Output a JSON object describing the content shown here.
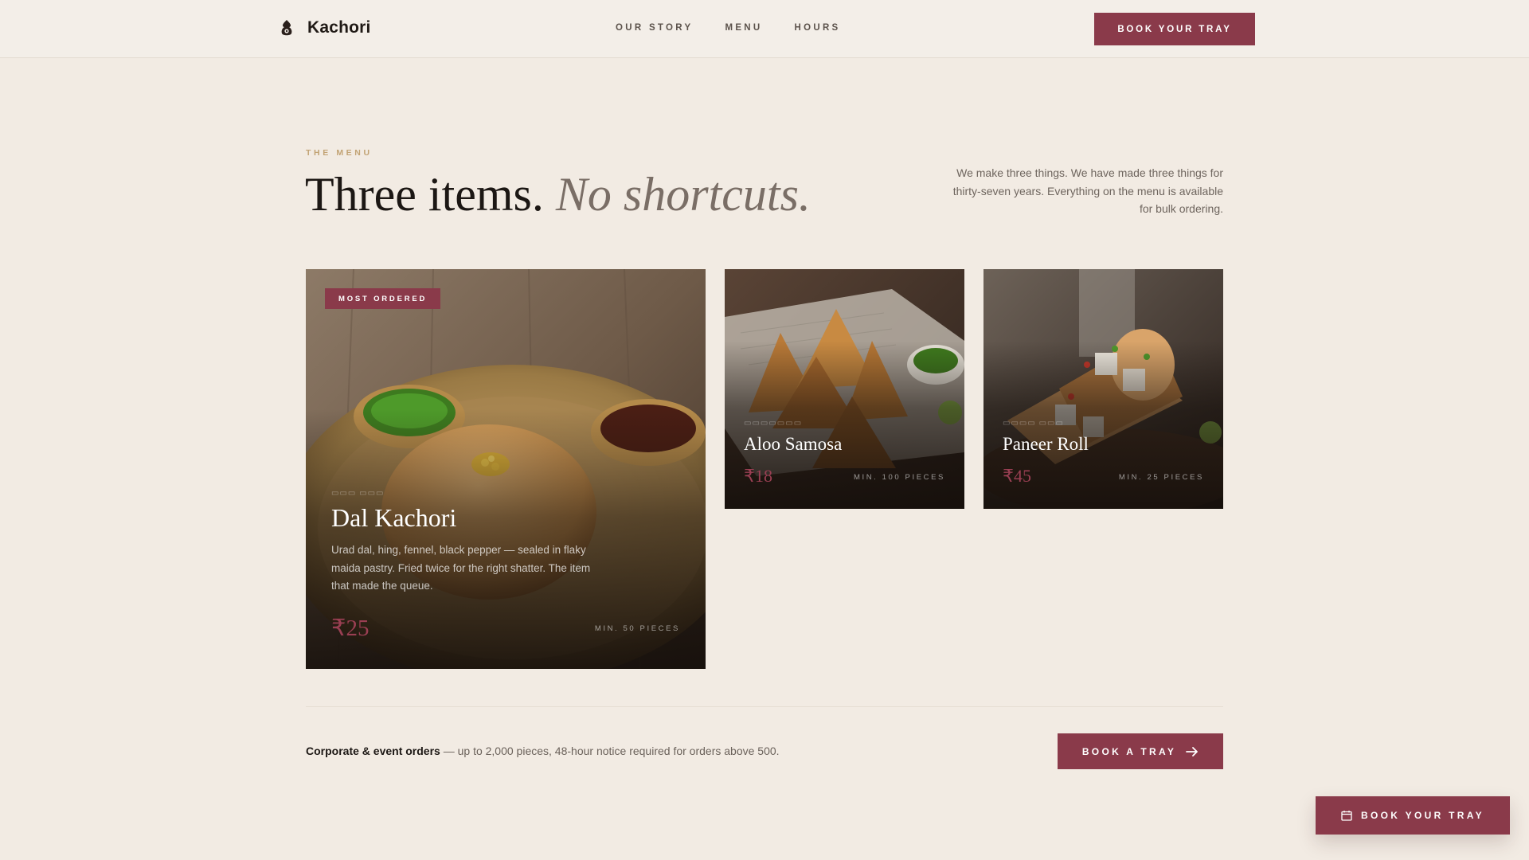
{
  "header": {
    "brand_name": "Kachori",
    "nav": [
      "OUR STORY",
      "MENU",
      "HOURS"
    ],
    "cta_label": "BOOK YOUR TRAY"
  },
  "intro": {
    "eyebrow": "THE MENU",
    "headline_main": "Three items.",
    "headline_italic": "No shortcuts.",
    "copy": "We make three things. We have made three things for thirty-seven years. Everything on the menu is available for bulk ordering."
  },
  "items": [
    {
      "badge": "MOST ORDERED",
      "title": "Dal Kachori",
      "description": "Urad dal, hing, fennel, black pepper — sealed in flaky maida pastry. Fried twice for the right shatter. The item that made the queue.",
      "price": "₹25",
      "minimum": "MIN. 50 PIECES"
    },
    {
      "title": "Aloo Samosa",
      "price": "₹18",
      "minimum": "MIN. 100 PIECES"
    },
    {
      "title": "Paneer Roll",
      "price": "₹45",
      "minimum": "MIN. 25 PIECES"
    }
  ],
  "footer": {
    "corporate_label": "Corporate & event orders",
    "corporate_text": "— up to 2,000 pieces, 48-hour notice required for orders above 500.",
    "book_tray_label": "BOOK A TRAY",
    "floating_cta_label": "BOOK YOUR TRAY"
  },
  "colors": {
    "accent": "#8a3a4a",
    "background": "#f2ebe3",
    "eyebrow": "#c2a374"
  }
}
